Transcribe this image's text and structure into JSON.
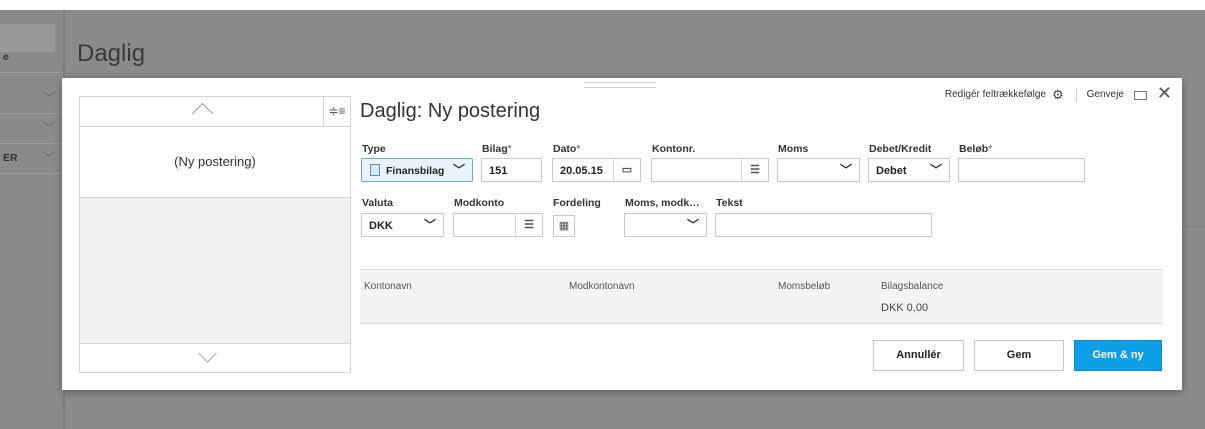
{
  "background": {
    "page_title": "Daglig",
    "side_rows": [
      {
        "label": "e"
      },
      {
        "label": ""
      },
      {
        "label": ""
      },
      {
        "label": "ER"
      }
    ]
  },
  "dialog": {
    "title": "Daglig: Ny postering",
    "toplinks": {
      "field_order": "Redigér feltrækkefølge",
      "shortcuts": "Genveje"
    },
    "list": {
      "items": [
        "(Ny postering)"
      ]
    },
    "fields": {
      "type": {
        "label": "Type",
        "value": "Finansbilag"
      },
      "bilag": {
        "label": "Bilag",
        "required": "*",
        "value": "151"
      },
      "dato": {
        "label": "Dato",
        "required": "*",
        "value": "20.05.15"
      },
      "kontonr": {
        "label": "Kontonr.",
        "value": ""
      },
      "moms": {
        "label": "Moms",
        "value": ""
      },
      "debet_kredit": {
        "label": "Debet/Kredit",
        "value": "Debet"
      },
      "beloeb": {
        "label": "Beløb",
        "required": "*",
        "value": ""
      },
      "valuta": {
        "label": "Valuta",
        "value": "DKK"
      },
      "modkonto": {
        "label": "Modkonto",
        "value": ""
      },
      "fordeling": {
        "label": "Fordeling"
      },
      "moms_modk": {
        "label": "Moms, modk…",
        "value": ""
      },
      "tekst": {
        "label": "Tekst",
        "value": ""
      }
    },
    "summary": {
      "kontonavn": {
        "label": "Kontonavn"
      },
      "modkontonavn": {
        "label": "Modkontonavn"
      },
      "momsbeloeb": {
        "label": "Momsbeløb"
      },
      "bilagsbalance": {
        "label": "Bilagsbalance",
        "value": "DKK 0,00"
      }
    },
    "buttons": {
      "cancel": "Annullér",
      "save": "Gem",
      "save_new": "Gem & ny"
    }
  },
  "colors": {
    "primary_button": "#0ea0e6",
    "selected_field": "#e9f3fb"
  }
}
